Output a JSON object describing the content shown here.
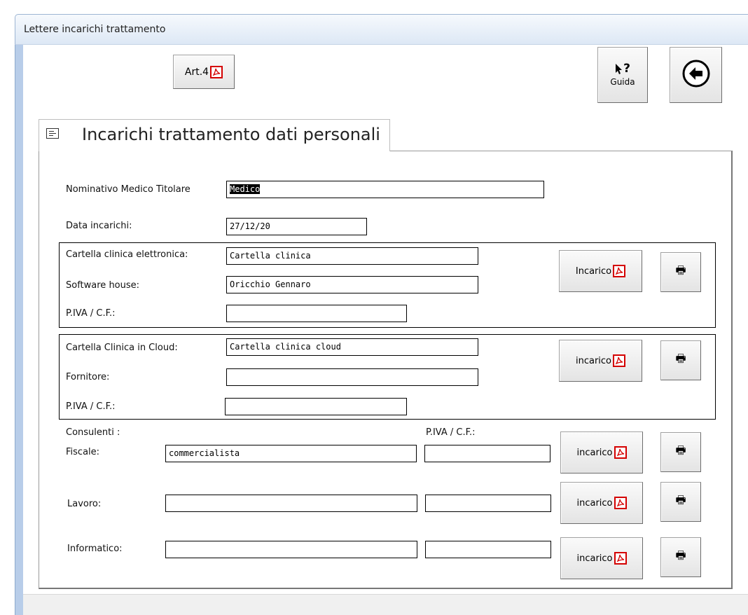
{
  "window": {
    "title": "Lettere incarichi trattamento"
  },
  "toolbar": {
    "art4_label": "Art.4",
    "help_label": "Guida",
    "help_icon": "?"
  },
  "tab": {
    "title": "Incarichi trattamento dati personali"
  },
  "form": {
    "medico_label": "Nominativo Medico Titolare",
    "medico_value": "Medico",
    "data_label": "Data incarichi:",
    "data_value": "27/12/20",
    "section1": {
      "cartella_label": "Cartella clinica elettronica:",
      "cartella_value": "Cartella clinica",
      "software_label": "Software house:",
      "software_value": "Oricchio Gennaro",
      "piva_label": "P.IVA / C.F.:",
      "piva_value": "",
      "incarico_label": "Incarico"
    },
    "section2": {
      "cloud_label": "Cartella Clinica in Cloud:",
      "cloud_value": "Cartella clinica cloud",
      "fornitore_label": "Fornitore:",
      "fornitore_value": "",
      "piva_label": "P.IVA / C.F.:",
      "piva_value": "",
      "incarico_label": "incarico"
    },
    "consulenti": {
      "heading": "Consulenti :",
      "piva_heading": "P.IVA / C.F.:",
      "rows": [
        {
          "label": "Fiscale:",
          "value": "commercialista",
          "piva": "",
          "incarico_label": "incarico"
        },
        {
          "label": "Lavoro:",
          "value": "",
          "piva": "",
          "incarico_label": "incarico"
        },
        {
          "label": "Informatico:",
          "value": "",
          "piva": "",
          "incarico_label": "incarico"
        }
      ]
    }
  },
  "icons": {
    "pdf": "pdf-icon",
    "printer": "printer-icon",
    "back": "back-arrow-icon",
    "help": "help-cursor-icon",
    "form": "form-icon"
  },
  "colors": {
    "pdf_red": "#d40000",
    "title_bar": "#dde8f5"
  }
}
